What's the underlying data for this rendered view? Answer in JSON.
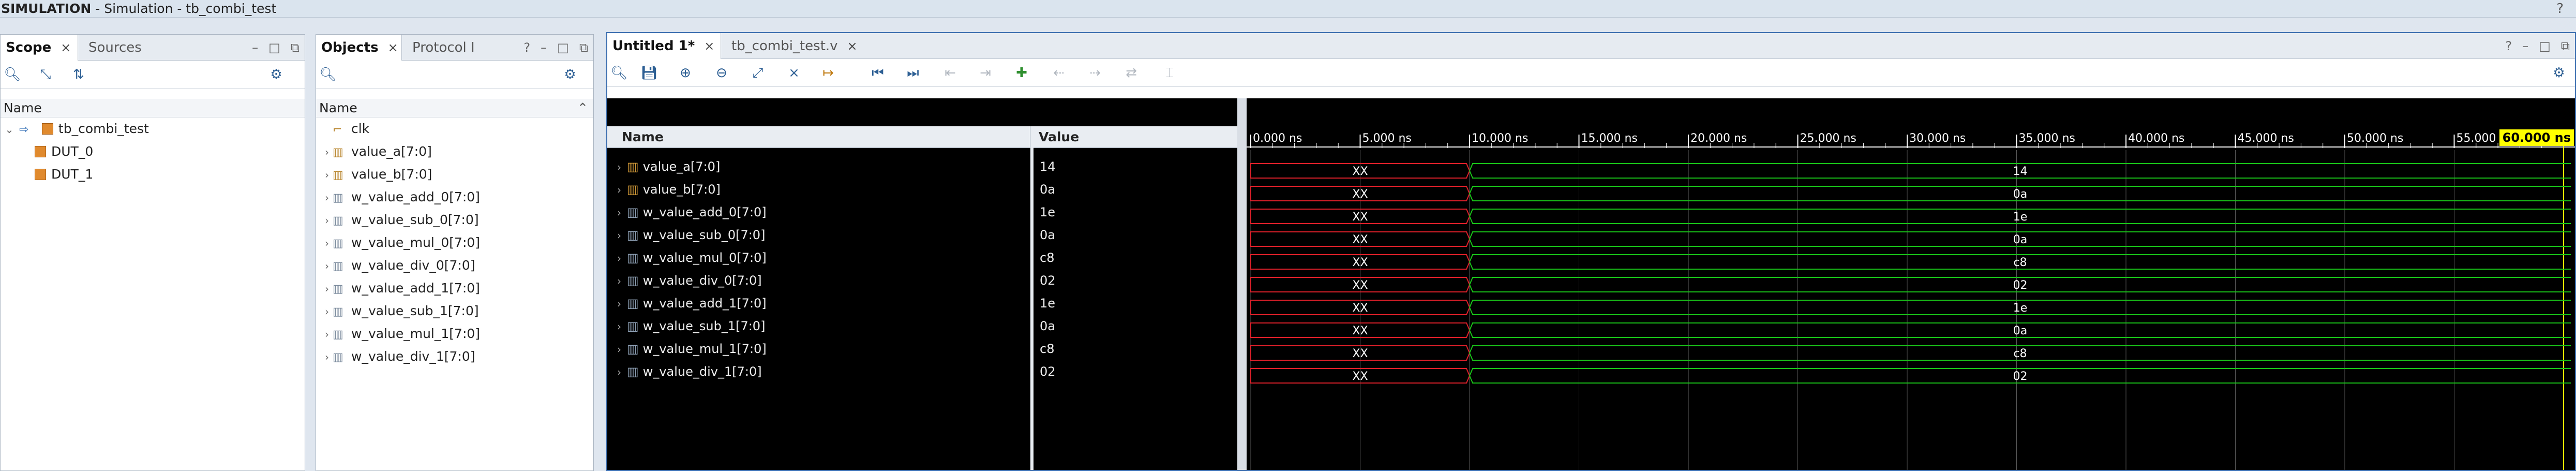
{
  "window": {
    "title_bold": "SIMULATION",
    "title_rest": " - Simulation - tb_combi_test",
    "help": "?"
  },
  "scope_panel": {
    "tabs": [
      {
        "label": "Scope",
        "close": "×"
      },
      {
        "label": "Sources",
        "close": ""
      }
    ],
    "controls": [
      "–",
      "□",
      "⧉"
    ],
    "column": "Name",
    "tree": [
      {
        "label": "tb_combi_test",
        "level": 0,
        "expanded": true
      },
      {
        "label": "DUT_0",
        "level": 1
      },
      {
        "label": "DUT_1",
        "level": 1
      }
    ]
  },
  "objects_panel": {
    "tabs": [
      {
        "label": "Objects",
        "close": "×"
      },
      {
        "label": "Protocol I",
        "close": ""
      }
    ],
    "controls": [
      "?",
      "–",
      "□",
      "⧉"
    ],
    "column": "Name",
    "items": [
      "clk",
      "value_a[7:0]",
      "value_b[7:0]",
      "w_value_add_0[7:0]",
      "w_value_sub_0[7:0]",
      "w_value_mul_0[7:0]",
      "w_value_div_0[7:0]",
      "w_value_add_1[7:0]",
      "w_value_sub_1[7:0]",
      "w_value_mul_1[7:0]",
      "w_value_div_1[7:0]"
    ]
  },
  "wave_panel": {
    "tabs": [
      {
        "label": "Untitled 1*",
        "close": "×"
      },
      {
        "label": "tb_combi_test.v",
        "close": "×"
      }
    ],
    "controls": [
      "?",
      "–",
      "□",
      "⧉"
    ],
    "name_header": "Name",
    "value_header": "Value",
    "cursor_label": "60.000 ns",
    "ticks": [
      "0.000 ns",
      "5.000 ns",
      "10.000 ns",
      "15.000 ns",
      "20.000 ns",
      "25.000 ns",
      "30.000 ns",
      "35.000 ns",
      "40.000 ns",
      "45.000 ns",
      "50.000 ns",
      "55.000 ns"
    ],
    "tick_times": [
      0,
      5,
      10,
      15,
      20,
      25,
      30,
      35,
      40,
      45,
      50,
      55
    ],
    "time_range_ns": [
      0,
      60
    ],
    "transition_ns": 10,
    "undefined_label": "XX",
    "colors": {
      "defined": "#19c419",
      "undefined": "#e0202a",
      "cursor": "#ffff00"
    },
    "signals": [
      {
        "name": "value_a[7:0]",
        "value": "14"
      },
      {
        "name": "value_b[7:0]",
        "value": "0a"
      },
      {
        "name": "w_value_add_0[7:0]",
        "value": "1e"
      },
      {
        "name": "w_value_sub_0[7:0]",
        "value": "0a"
      },
      {
        "name": "w_value_mul_0[7:0]",
        "value": "c8"
      },
      {
        "name": "w_value_div_0[7:0]",
        "value": "02"
      },
      {
        "name": "w_value_add_1[7:0]",
        "value": "1e"
      },
      {
        "name": "w_value_sub_1[7:0]",
        "value": "0a"
      },
      {
        "name": "w_value_mul_1[7:0]",
        "value": "c8"
      },
      {
        "name": "w_value_div_1[7:0]",
        "value": "02"
      }
    ]
  }
}
